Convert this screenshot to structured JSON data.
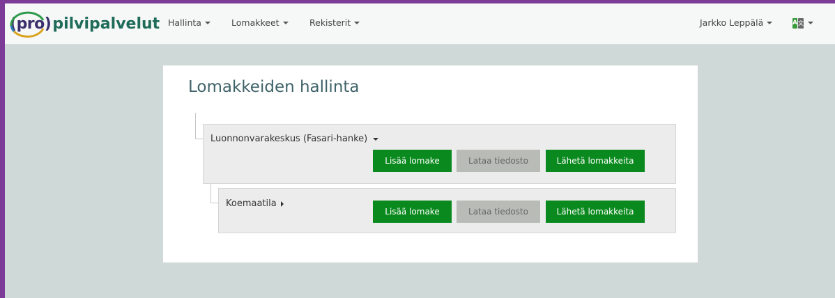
{
  "brand": {
    "pro_text": "pro",
    "open_paren": "(",
    "close_paren": ")",
    "name_text": "pilvipalvelut"
  },
  "nav": {
    "items": [
      {
        "label": "Hallinta"
      },
      {
        "label": "Lomakkeet"
      },
      {
        "label": "Rekisterit"
      }
    ],
    "user": "Jarkko Leppälä",
    "language_icon": "translate-icon"
  },
  "page": {
    "title": "Lomakkeiden hallinta"
  },
  "tree": {
    "org": {
      "label": "Luonnonvarakeskus (Fasari-hanke)",
      "expand_icon": "chevron-down-icon",
      "buttons": {
        "add": "Lisää lomake",
        "upload": "Lataa tiedosto",
        "send": "Lähetä lomakkeita"
      }
    },
    "farm": {
      "label": "Koemaatila",
      "expand_icon": "chevron-right-icon",
      "buttons": {
        "add": "Lisää lomake",
        "upload": "Lataa tiedosto",
        "send": "Lähetä lomakkeita"
      }
    }
  },
  "colors": {
    "frame_border": "#7b3b96",
    "background": "#ced9d8",
    "button_green": "#0a8a1e",
    "button_disabled": "#b9bcb6",
    "title": "#3f6369"
  }
}
